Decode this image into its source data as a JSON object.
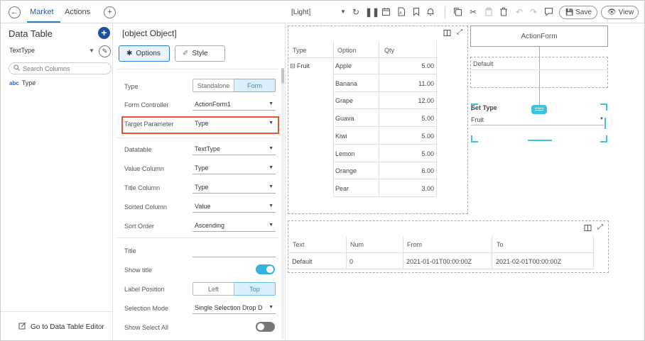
{
  "topbar": {
    "tabs": [
      {
        "label": "Market"
      },
      {
        "label": "Actions"
      }
    ],
    "theme_label": "[Light]",
    "save_label": "Save",
    "view_label": "View",
    "icons": [
      "back-icon",
      "add-tab-icon",
      "dropdown-icon",
      "refresh-icon",
      "pause-icon",
      "calendar-icon",
      "export-pdf-icon",
      "bookmark-icon",
      "notification-icon",
      "copy-icon",
      "cut-icon",
      "paste-icon",
      "delete-icon",
      "undo-icon",
      "redo-icon",
      "comment-icon",
      "save-icon",
      "view-icon"
    ],
    "accent_color": "#2a79c9"
  },
  "left_panel": {
    "title": "Data Table",
    "datatable_value": "TextType",
    "search_placeholder": "Search Columns",
    "column": {
      "type_badge": "abc",
      "name": "Type"
    },
    "footer_link": "Go to Data Table Editor"
  },
  "settings": {
    "title": {
      "label": "Title",
      "value": ""
    },
    "tabs": {
      "options": "Options",
      "style": "Style"
    },
    "type": {
      "label": "Type",
      "options": [
        "Standalone",
        "Form"
      ],
      "selected": "Form"
    },
    "form_controller": {
      "label": "Form Controller",
      "value": "ActionForm1"
    },
    "target_parameter": {
      "label": "Target Parameter",
      "value": "Type"
    },
    "datatable": {
      "label": "Datatable",
      "value": "TextType"
    },
    "value_column": {
      "label": "Value Column",
      "value": "Type"
    },
    "title_column": {
      "label": "Title Column",
      "value": "Type"
    },
    "sorted_column": {
      "label": "Sorted Column",
      "value": "Value"
    },
    "sort_order": {
      "label": "Sort Order",
      "value": "Ascending"
    },
    "show_title": {
      "label": "Show title",
      "on": true
    },
    "label_position": {
      "label": "Label Position",
      "options": [
        "Left",
        "Top"
      ],
      "selected": "Top"
    },
    "selection_mode": {
      "label": "Selection Mode",
      "value": "Single Selection Drop D"
    },
    "show_select_all": {
      "label": "Show Select All",
      "on": false
    },
    "highlight_color": "#e8562a"
  },
  "canvas": {
    "fruit_table": {
      "headers": [
        "Type",
        "Option",
        "Qty"
      ],
      "group": "Fruit",
      "rows": [
        {
          "option": "Apple",
          "qty": "5.00"
        },
        {
          "option": "Banana",
          "qty": "11.00"
        },
        {
          "option": "Grape",
          "qty": "12.00"
        },
        {
          "option": "Guava",
          "qty": "5.00"
        },
        {
          "option": "Kiwi",
          "qty": "5.00"
        },
        {
          "option": "Lemon",
          "qty": "5.00"
        },
        {
          "option": "Orange",
          "qty": "6.00"
        },
        {
          "option": "Pear",
          "qty": "3.00"
        }
      ]
    },
    "action_form": {
      "title": "ActionForm",
      "default_label": "Default",
      "set_type_label": "Set Type",
      "set_type_value": "Fruit",
      "selection_color": "#3cc3e0",
      "arrow_color": "#e8562a"
    },
    "param_table": {
      "headers": [
        "Text",
        "Num",
        "From",
        "To"
      ],
      "row": [
        "Default",
        "0",
        "2021-01-01T00:00:00Z",
        "2021-02-01T00:00:00Z"
      ]
    }
  }
}
